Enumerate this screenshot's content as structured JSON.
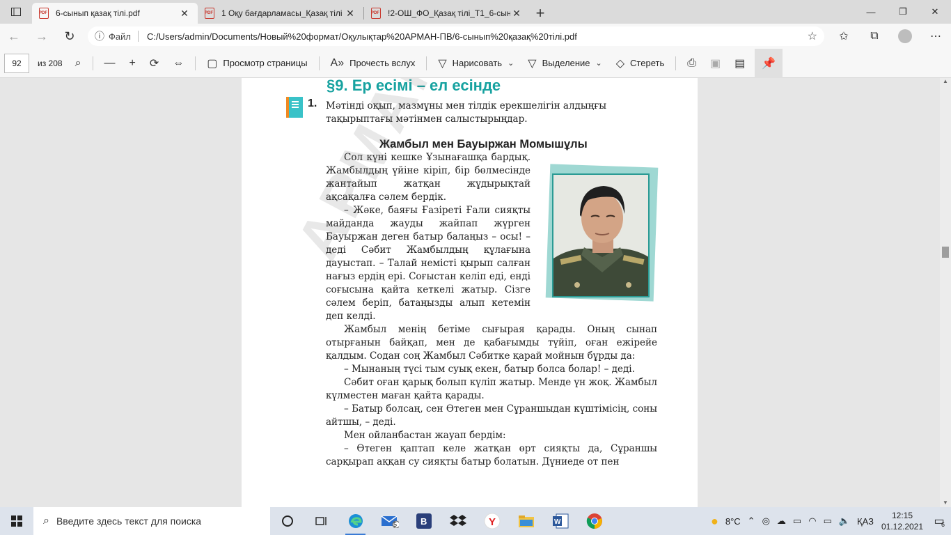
{
  "browser": {
    "tabs": [
      {
        "title": "6-сынып қазақ тілі.pdf",
        "active": true
      },
      {
        "title": "1 Оқу бағдарламасы_Қазақ тілі",
        "active": false
      },
      {
        "title": "!2-ОШ_ФО_Қазақ тілі_Т1_6-сын",
        "active": false
      }
    ],
    "address": {
      "scheme_label": "Файл",
      "url": "C:/Users/admin/Documents/Новый%20формат/Оқулықтар%20АРМАН-ПВ/6-сынып%20қазақ%20тілі.pdf"
    }
  },
  "pdf_toolbar": {
    "page_current": "92",
    "page_total": "из 208",
    "view_label": "Просмотр страницы",
    "read_aloud_label": "Прочесть вслух",
    "draw_label": "Нарисовать",
    "highlight_label": "Выделение",
    "erase_label": "Стереть"
  },
  "page": {
    "section_title": "§9. Ер есімі – ел есінде",
    "task_number": "1.",
    "task_text": "Мәтінді оқып, мазмұны мен тілдік ерекшелігін алдыңғы тақырыптағы мәтінмен салыстырыңдар.",
    "story_title": "Жамбыл мен Бауыржан Момышұлы",
    "paragraphs_narrow": [
      "Сол күні кешке Ұзынағашқа бардық. Жамбылдың үйіне кіріп, бір бөлмесінде жантайып жатқан жұдырықтай ақсақалға сәлем бердік.",
      "– Жәке, баяғы Ғазіреті Ғали сияқты майданда жауды жайпап жүрген Бауыржан деген батыр балаңыз – осы! – деді Сәбит Жамбылдың құлағына дауыстап. – Талай немісті қырып салған нағыз ердің ері. Соғыстан келіп еді, енді соғысына қайта кеткелі жатыр. Сізге сәлем беріп, батаңызды алып кетемін деп келді."
    ],
    "paragraphs_full": [
      "Жамбыл менің бетіме сығырая қарады. Оның сынап отырғанын байқап, мен де қабағымды түйіп, оған ежірейе қалдым. Содан соң Жамбыл Сәбитке қарай мойнын бұрды да:",
      "– Мынаның түсі тым суық екен, батыр болса болар! – деді.",
      "Сәбит оған қарық болып күліп жатыр. Менде үн жоқ. Жамбыл күлместен маған қайта қарады.",
      "– Батыр болсаң, сен Өтеген мен Сұраншыдан күштімісің, соны айтшы, – деді.",
      "Мен ойланбастан жауап бердім:",
      "– Өтеген қаптап келе жатқан өрт сияқты да, Сұраншы сарқырап аққан су сияқты батыр болатын. Дүниеде от пен"
    ],
    "watermark": "АРМАН-ПВ баспасы"
  },
  "taskbar": {
    "search_placeholder": "Введите здесь текст для поиска",
    "weather": "8°C",
    "language": "ҚАЗ",
    "time": "12:15",
    "date": "01.12.2021",
    "notification_count": "6",
    "mail_badge": "5"
  }
}
